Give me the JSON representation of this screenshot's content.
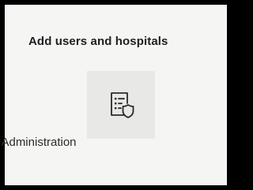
{
  "card": {
    "title": "Add users and hospitals"
  },
  "tiles": [
    {
      "label": "Administration",
      "icon": "document-shield-icon"
    }
  ]
}
